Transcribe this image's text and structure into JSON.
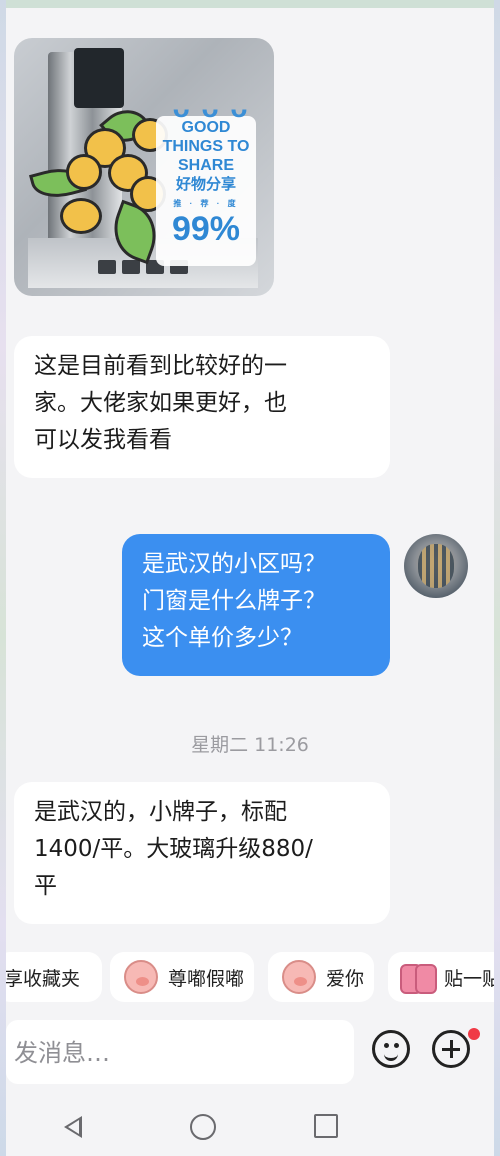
{
  "messages": [
    {
      "type": "image",
      "sticker": {
        "line1": "GOOD",
        "line2": "THINGS TO",
        "line3": "SHARE",
        "line4": "好物分享",
        "line5": "推 · 荐 · 度",
        "line6": "99%"
      }
    },
    {
      "type": "text",
      "direction": "incoming",
      "lines": [
        "这是目前看到比较好的一",
        "家。大佬家如果更好，也",
        "可以发我看看"
      ]
    },
    {
      "type": "text",
      "direction": "outgoing",
      "lines": [
        "是武汉的小区吗？",
        "门窗是什么牌子？",
        "这个单价多少？"
      ]
    },
    {
      "type": "timestamp",
      "text": "星期二 11:26"
    },
    {
      "type": "text",
      "direction": "incoming",
      "lines": [
        "是武汉的，小牌子，标配",
        "1400/平。大玻璃升级880/",
        "平"
      ]
    }
  ],
  "quick_replies": [
    {
      "label": "享收藏夹",
      "icon": "none"
    },
    {
      "label": "尊嘟假嘟",
      "icon": "pig-face-icon"
    },
    {
      "label": "爱你",
      "icon": "pig-face-icon"
    },
    {
      "label": "贴一贴",
      "icon": "two-pigs-icon"
    }
  ],
  "input": {
    "placeholder": "发消息…",
    "value": ""
  },
  "colors": {
    "outgoing_bubble": "#3b8ff0",
    "incoming_bubble": "#ffffff",
    "background": "#f4f4f6",
    "badge": "#f03a46"
  }
}
